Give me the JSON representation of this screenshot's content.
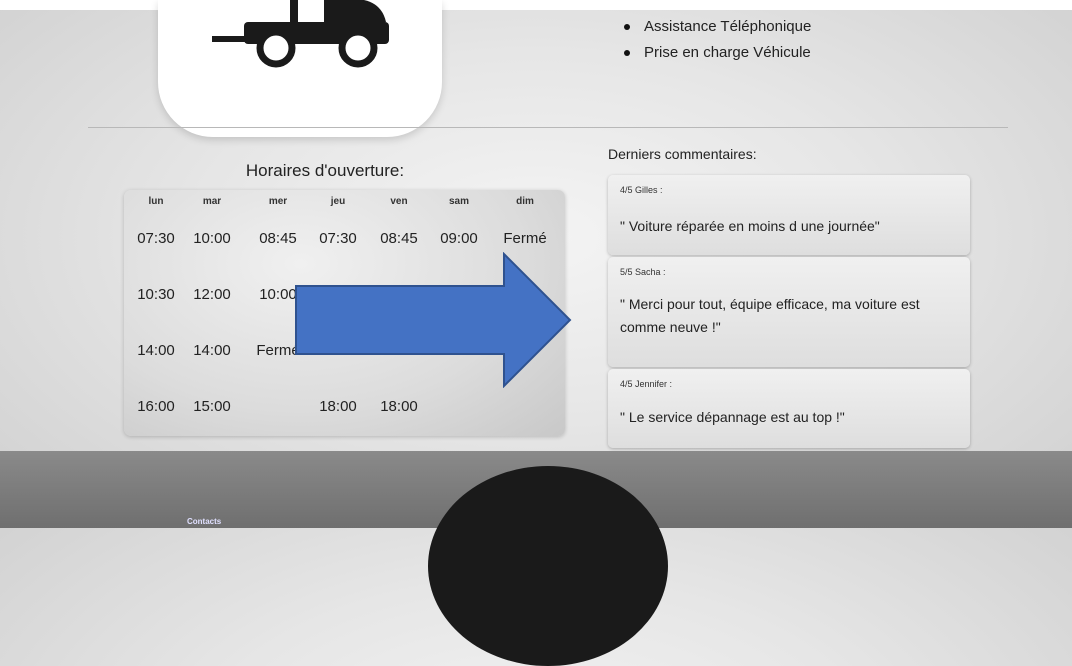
{
  "services": [
    "Assistance Téléphonique",
    "Prise en charge Véhicule"
  ],
  "hours": {
    "title": "Horaires d'ouverture:",
    "days": [
      "lun",
      "mar",
      "mer",
      "jeu",
      "ven",
      "sam",
      "dim"
    ],
    "rows": [
      [
        "07:30",
        "10:00",
        "08:45",
        "07:30",
        "08:45",
        "09:00",
        "Fermé"
      ],
      [
        "10:30",
        "12:00",
        "10:00",
        "",
        "",
        "",
        ""
      ],
      [
        "14:00",
        "14:00",
        "Fermé",
        "",
        "",
        "",
        ""
      ],
      [
        "16:00",
        "15:00",
        "",
        "18:00",
        "18:00",
        "",
        ""
      ]
    ]
  },
  "comments": {
    "title": "Derniers commentaires:",
    "items": [
      {
        "author": "4/5 Gilles :",
        "text": "\" Voiture réparée en moins d une journée\""
      },
      {
        "author": "5/5 Sacha :",
        "text": "\" Merci pour tout, équipe efficace, ma voiture est comme neuve !\""
      },
      {
        "author": "4/5 Jennifer :",
        "text": "\" Le service dépannage est au top !\""
      }
    ]
  },
  "footer": {
    "contacts_label": "Contacts"
  },
  "colors": {
    "arrow": "#4472c4",
    "arrow_border": "#2f528f"
  }
}
